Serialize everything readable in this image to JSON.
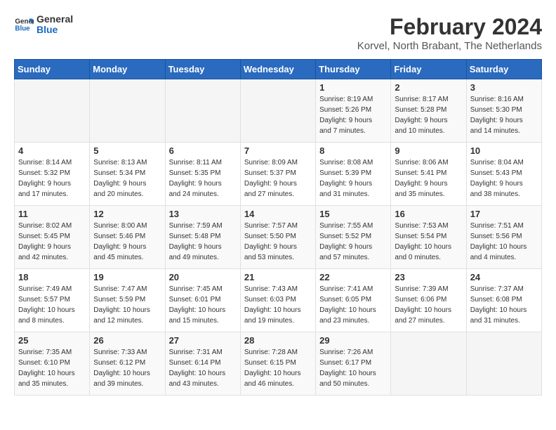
{
  "header": {
    "logo_line1": "General",
    "logo_line2": "Blue",
    "title": "February 2024",
    "subtitle": "Korvel, North Brabant, The Netherlands"
  },
  "days_of_week": [
    "Sunday",
    "Monday",
    "Tuesday",
    "Wednesday",
    "Thursday",
    "Friday",
    "Saturday"
  ],
  "weeks": [
    [
      {
        "day": "",
        "info": ""
      },
      {
        "day": "",
        "info": ""
      },
      {
        "day": "",
        "info": ""
      },
      {
        "day": "",
        "info": ""
      },
      {
        "day": "1",
        "info": "Sunrise: 8:19 AM\nSunset: 5:26 PM\nDaylight: 9 hours\nand 7 minutes."
      },
      {
        "day": "2",
        "info": "Sunrise: 8:17 AM\nSunset: 5:28 PM\nDaylight: 9 hours\nand 10 minutes."
      },
      {
        "day": "3",
        "info": "Sunrise: 8:16 AM\nSunset: 5:30 PM\nDaylight: 9 hours\nand 14 minutes."
      }
    ],
    [
      {
        "day": "4",
        "info": "Sunrise: 8:14 AM\nSunset: 5:32 PM\nDaylight: 9 hours\nand 17 minutes."
      },
      {
        "day": "5",
        "info": "Sunrise: 8:13 AM\nSunset: 5:34 PM\nDaylight: 9 hours\nand 20 minutes."
      },
      {
        "day": "6",
        "info": "Sunrise: 8:11 AM\nSunset: 5:35 PM\nDaylight: 9 hours\nand 24 minutes."
      },
      {
        "day": "7",
        "info": "Sunrise: 8:09 AM\nSunset: 5:37 PM\nDaylight: 9 hours\nand 27 minutes."
      },
      {
        "day": "8",
        "info": "Sunrise: 8:08 AM\nSunset: 5:39 PM\nDaylight: 9 hours\nand 31 minutes."
      },
      {
        "day": "9",
        "info": "Sunrise: 8:06 AM\nSunset: 5:41 PM\nDaylight: 9 hours\nand 35 minutes."
      },
      {
        "day": "10",
        "info": "Sunrise: 8:04 AM\nSunset: 5:43 PM\nDaylight: 9 hours\nand 38 minutes."
      }
    ],
    [
      {
        "day": "11",
        "info": "Sunrise: 8:02 AM\nSunset: 5:45 PM\nDaylight: 9 hours\nand 42 minutes."
      },
      {
        "day": "12",
        "info": "Sunrise: 8:00 AM\nSunset: 5:46 PM\nDaylight: 9 hours\nand 45 minutes."
      },
      {
        "day": "13",
        "info": "Sunrise: 7:59 AM\nSunset: 5:48 PM\nDaylight: 9 hours\nand 49 minutes."
      },
      {
        "day": "14",
        "info": "Sunrise: 7:57 AM\nSunset: 5:50 PM\nDaylight: 9 hours\nand 53 minutes."
      },
      {
        "day": "15",
        "info": "Sunrise: 7:55 AM\nSunset: 5:52 PM\nDaylight: 9 hours\nand 57 minutes."
      },
      {
        "day": "16",
        "info": "Sunrise: 7:53 AM\nSunset: 5:54 PM\nDaylight: 10 hours\nand 0 minutes."
      },
      {
        "day": "17",
        "info": "Sunrise: 7:51 AM\nSunset: 5:56 PM\nDaylight: 10 hours\nand 4 minutes."
      }
    ],
    [
      {
        "day": "18",
        "info": "Sunrise: 7:49 AM\nSunset: 5:57 PM\nDaylight: 10 hours\nand 8 minutes."
      },
      {
        "day": "19",
        "info": "Sunrise: 7:47 AM\nSunset: 5:59 PM\nDaylight: 10 hours\nand 12 minutes."
      },
      {
        "day": "20",
        "info": "Sunrise: 7:45 AM\nSunset: 6:01 PM\nDaylight: 10 hours\nand 15 minutes."
      },
      {
        "day": "21",
        "info": "Sunrise: 7:43 AM\nSunset: 6:03 PM\nDaylight: 10 hours\nand 19 minutes."
      },
      {
        "day": "22",
        "info": "Sunrise: 7:41 AM\nSunset: 6:05 PM\nDaylight: 10 hours\nand 23 minutes."
      },
      {
        "day": "23",
        "info": "Sunrise: 7:39 AM\nSunset: 6:06 PM\nDaylight: 10 hours\nand 27 minutes."
      },
      {
        "day": "24",
        "info": "Sunrise: 7:37 AM\nSunset: 6:08 PM\nDaylight: 10 hours\nand 31 minutes."
      }
    ],
    [
      {
        "day": "25",
        "info": "Sunrise: 7:35 AM\nSunset: 6:10 PM\nDaylight: 10 hours\nand 35 minutes."
      },
      {
        "day": "26",
        "info": "Sunrise: 7:33 AM\nSunset: 6:12 PM\nDaylight: 10 hours\nand 39 minutes."
      },
      {
        "day": "27",
        "info": "Sunrise: 7:31 AM\nSunset: 6:14 PM\nDaylight: 10 hours\nand 43 minutes."
      },
      {
        "day": "28",
        "info": "Sunrise: 7:28 AM\nSunset: 6:15 PM\nDaylight: 10 hours\nand 46 minutes."
      },
      {
        "day": "29",
        "info": "Sunrise: 7:26 AM\nSunset: 6:17 PM\nDaylight: 10 hours\nand 50 minutes."
      },
      {
        "day": "",
        "info": ""
      },
      {
        "day": "",
        "info": ""
      }
    ]
  ]
}
